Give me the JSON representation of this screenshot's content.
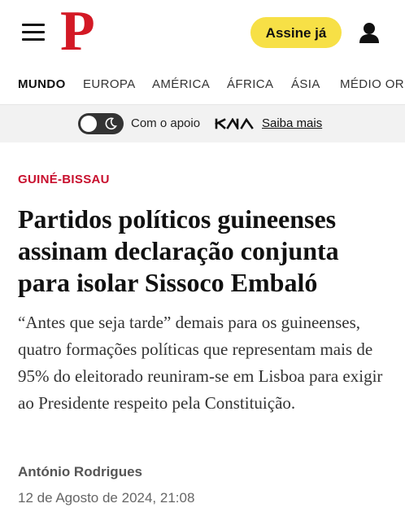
{
  "header": {
    "logo_text": "P",
    "subscribe_label": "Assine já",
    "menu_icon": "hamburger-menu-icon",
    "account_icon": "user-icon"
  },
  "nav": {
    "items": [
      {
        "label": "MUNDO",
        "active": true
      },
      {
        "label": "EUROPA",
        "active": false
      },
      {
        "label": "AMÉRICA",
        "active": false
      },
      {
        "label": "ÁFRICA",
        "active": false
      },
      {
        "label": "ÁSIA",
        "active": false
      },
      {
        "label": "MÉDIO ORIENTE",
        "active": false
      }
    ]
  },
  "support": {
    "text": "Com o apoio",
    "sponsor_logo_text": "KIA",
    "link_label": "Saiba mais",
    "theme_icon": "moon-icon"
  },
  "article": {
    "section": "GUINÉ-BISSAU",
    "headline": "Partidos políticos guineenses assinam declaração conjunta para isolar Sissoco Embaló",
    "lead": "“Antes que seja tarde” demais para os guineenses, quatro formações políticas que representam mais de 95% do eleitorado reuniram-se em Lisboa para exigir ao Presidente respeito pela Constituição.",
    "author": "António Rodrigues",
    "date": "12 de Agosto de 2024, 21:08"
  },
  "colors": {
    "brand": "#d31925",
    "subscribe_bg": "#f7e046",
    "section_label": "#c8102e",
    "support_bg": "#f2f2f2"
  }
}
